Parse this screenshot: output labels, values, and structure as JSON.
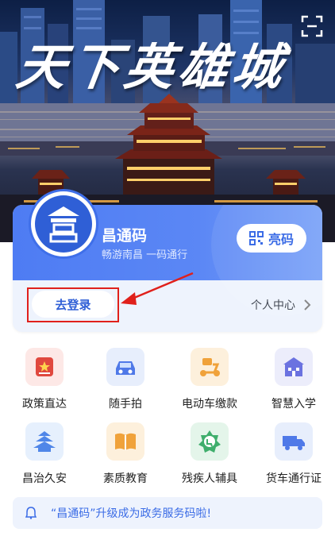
{
  "hero": {
    "title": "天下英雄城",
    "scan_icon": "scan-icon"
  },
  "card": {
    "title": "昌通码",
    "subtitle": "畅游南昌 一码通行",
    "bright_button_label": "亮码",
    "login_button_label": "去登录",
    "personal_center_label": "个人中心"
  },
  "services": [
    {
      "label": "政策直达",
      "icon": "policy-icon",
      "color": "#e0483e"
    },
    {
      "label": "随手拍",
      "icon": "car-icon",
      "color": "#4f79e8"
    },
    {
      "label": "电动车缴款",
      "icon": "scooter-icon",
      "color": "#f0a23a"
    },
    {
      "label": "智慧入学",
      "icon": "school-icon",
      "color": "#6b72e0"
    },
    {
      "label": "昌治久安",
      "icon": "pavilion-icon",
      "color": "#4f86e8"
    },
    {
      "label": "素质教育",
      "icon": "book-icon",
      "color": "#f0a23a"
    },
    {
      "label": "残疾人辅具",
      "icon": "disability-icon",
      "color": "#3fae6c"
    },
    {
      "label": "货车通行证",
      "icon": "truck-icon",
      "color": "#4f79e8"
    }
  ],
  "notice": {
    "text": "“昌通码”升级成为政务服务码啦!",
    "icon": "bell-icon"
  },
  "colors": {
    "accent": "#3b6ce6",
    "highlight": "#e0201b"
  }
}
